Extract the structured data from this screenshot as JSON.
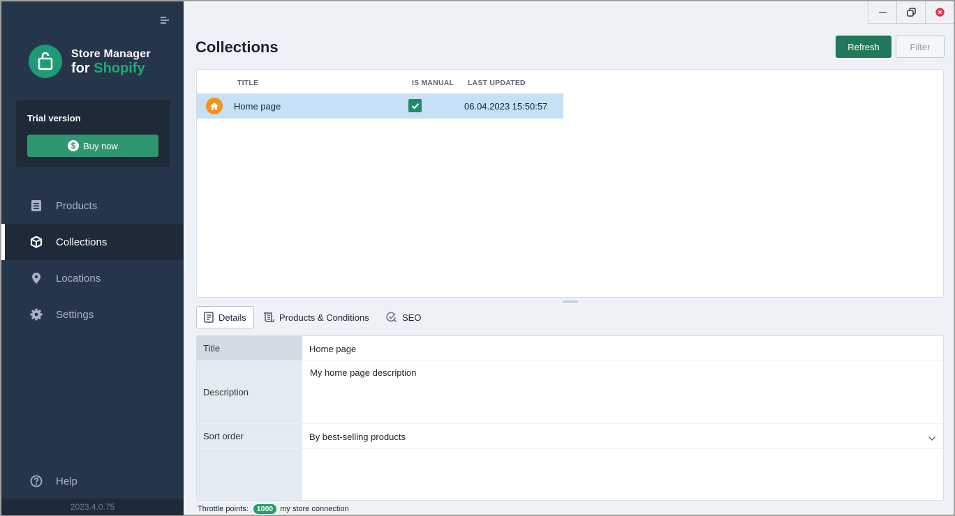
{
  "app": {
    "logo_line1": "Store Manager",
    "logo_line2_prefix": "for",
    "logo_line2_accent": "Shopify",
    "version": "2023.4.0.75"
  },
  "trial": {
    "label": "Trial version",
    "buy_label": "Buy now"
  },
  "sidebar": {
    "items": [
      {
        "label": "Products",
        "icon": "document-icon",
        "active": false
      },
      {
        "label": "Collections",
        "icon": "cube-icon",
        "active": true
      },
      {
        "label": "Locations",
        "icon": "map-pin-icon",
        "active": false
      },
      {
        "label": "Settings",
        "icon": "gear-icon",
        "active": false
      }
    ],
    "help_label": "Help"
  },
  "header": {
    "title": "Collections",
    "refresh_label": "Refresh",
    "filter_label": "Filter"
  },
  "grid": {
    "columns": [
      "TITLE",
      "IS MANUAL",
      "LAST UPDATED"
    ],
    "rows": [
      {
        "icon": "home-icon",
        "title": "Home page",
        "is_manual": true,
        "last_updated": "06.04.2023 15:50:57",
        "selected": true
      }
    ]
  },
  "tabs": [
    {
      "label": "Details",
      "icon": "document-icon",
      "active": true
    },
    {
      "label": "Products & Conditions",
      "icon": "scroll-icon",
      "active": false
    },
    {
      "label": "SEO",
      "icon": "seo-check-icon",
      "active": false
    }
  ],
  "details": {
    "title_label": "Title",
    "title_value": "Home page",
    "description_label": "Description",
    "description_value": "My home page description",
    "sort_label": "Sort order",
    "sort_value": "By best-selling products"
  },
  "status": {
    "throttle_label": "Throttle points:",
    "throttle_value": "1000",
    "connection": "my store connection"
  },
  "colors": {
    "sidebar_bg": "#26364a",
    "accent_green": "#22785a",
    "brand_green": "#1f9b73",
    "selected_row": "#c6e0f8",
    "home_icon": "#f59317",
    "close_red": "#e0344a"
  }
}
